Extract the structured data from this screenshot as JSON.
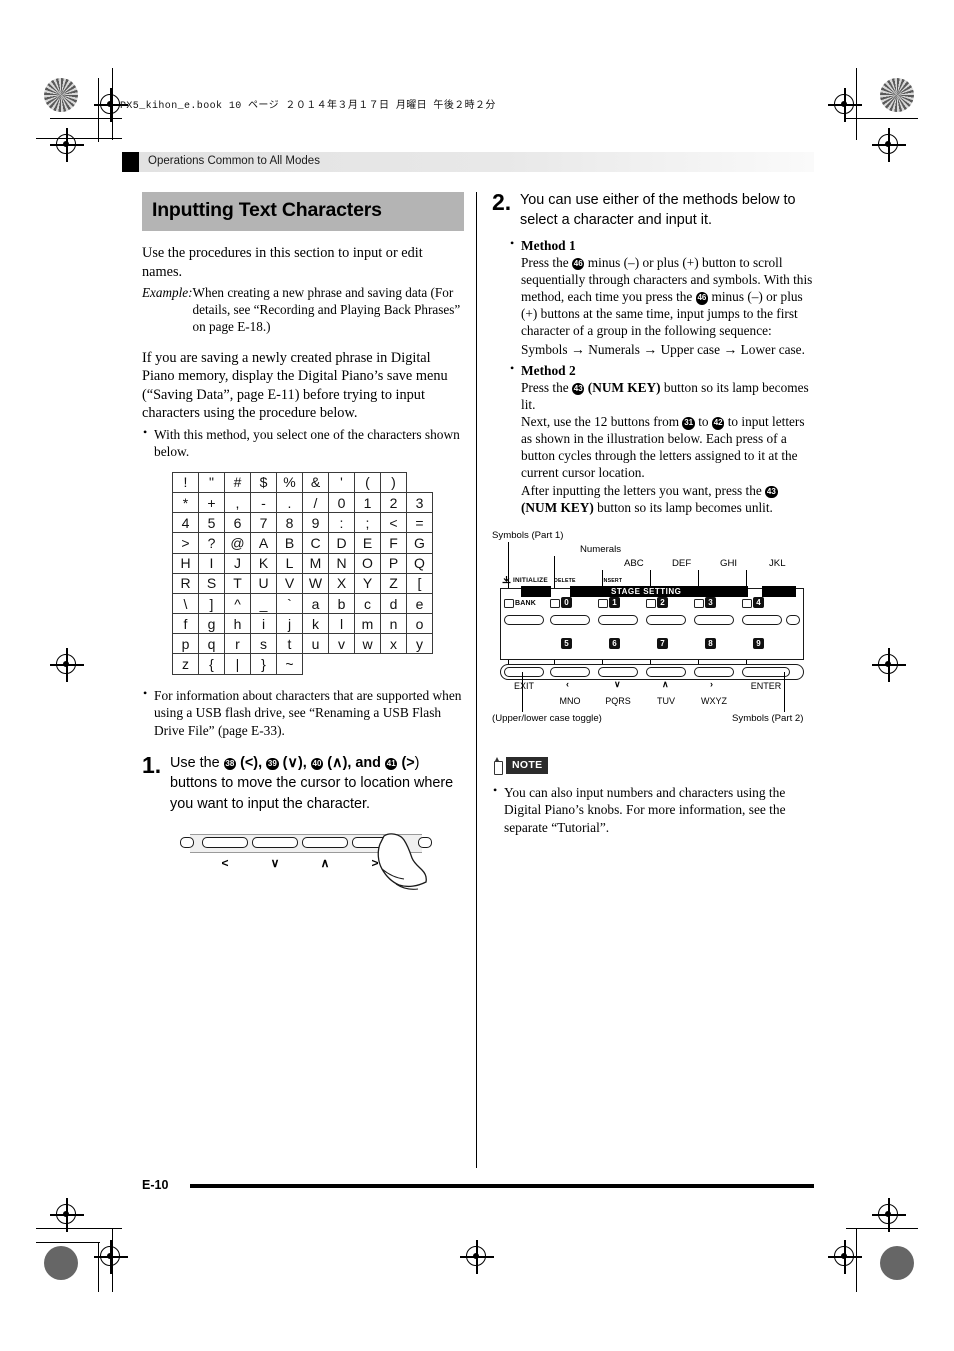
{
  "book_line": "PX5_kihon_e.book   10 ページ   ２０１４年３月１７日   月曜日   午後２時２分",
  "running_head": "Operations Common to All Modes",
  "page_number": "E-10",
  "left_column": {
    "section_title": "Inputting Text Characters",
    "intro": "Use the procedures in this section to input or edit names.",
    "example_label": "Example:",
    "example_text": "When creating a new phrase and saving data (For details, see “Recording and Playing Back Phrases” on page E-18.)",
    "paragraph": "If you are saving a newly created phrase in Digital Piano memory, display the Digital Piano’s save menu (“Saving Data”, page E-11) before trying to input characters using the procedure below.",
    "bullet_above_table": "With this method, you select one of the characters shown below.",
    "bullet_below_table": "For information about characters that are supported when using a USB flash drive, see “Renaming a USB Flash Drive File” (page E-33).",
    "char_table": [
      [
        "!",
        "\"",
        "#",
        "$",
        "%",
        "&",
        "'",
        "(",
        ")"
      ],
      [
        "*",
        "+",
        ",",
        "-",
        ".",
        "/",
        "0",
        "1",
        "2",
        "3"
      ],
      [
        "4",
        "5",
        "6",
        "7",
        "8",
        "9",
        ":",
        ";",
        "<",
        "="
      ],
      [
        ">",
        "?",
        "@",
        "A",
        "B",
        "C",
        "D",
        "E",
        "F",
        "G"
      ],
      [
        "H",
        "I",
        "J",
        "K",
        "L",
        "M",
        "N",
        "O",
        "P",
        "Q"
      ],
      [
        "R",
        "S",
        "T",
        "U",
        "V",
        "W",
        "X",
        "Y",
        "Z",
        "["
      ],
      [
        "\\",
        "]",
        "^",
        "_",
        "`",
        "a",
        "b",
        "c",
        "d",
        "e"
      ],
      [
        "f",
        "g",
        "h",
        "i",
        "j",
        "k",
        "l",
        "m",
        "n",
        "o"
      ],
      [
        "p",
        "q",
        "r",
        "s",
        "t",
        "u",
        "v",
        "w",
        "x",
        "y"
      ],
      [
        "z",
        "{",
        "|",
        "}",
        "~"
      ]
    ],
    "step1": {
      "number": "1.",
      "text_a": "Use the ",
      "ref_38": "38",
      "paren_left": " (",
      "sym_left": "<",
      "after_left": "), ",
      "ref_39": "39",
      "sym_down": "∨",
      "after_down": "), ",
      "ref_40": "40",
      "sym_up": "∧",
      "after_up": "), and ",
      "ref_41": "41",
      "sym_right": ">",
      "text_b": ") buttons to move the cursor to location where you want to input the character."
    },
    "keyboard_glyphs": [
      "<",
      "∨",
      "∧",
      ">"
    ]
  },
  "right_column": {
    "step2": {
      "number": "2.",
      "text": "You can use either of the methods below to select a character and input it."
    },
    "method1": {
      "heading": "Method 1",
      "seg1": "Press the ",
      "ref_a": "46",
      "seg2": " minus (–) or plus (+) button to scroll sequentially through characters and symbols. With this method, each time you press the ",
      "ref_b": "46",
      "seg3": " minus (–) or plus (+) buttons at the same time, input jumps to the first character of a group in the following sequence: Symbols ",
      "arrow": "→",
      "seq1": "Symbols",
      "seq2": "Numerals",
      "seq3": "Upper case",
      "seq4": "Lower case."
    },
    "method2": {
      "heading": "Method 2",
      "p1_a": "Press the ",
      "p1_ref": "43",
      "p1_b": " (NUM KEY) button so its lamp becomes lit.",
      "p2_a": "Next, use the 12 buttons from ",
      "p2_ref1": "31",
      "p2_mid": " to ",
      "p2_ref2": "42",
      "p2_b": " to input letters as shown in the illustration below. Each press of a button cycles through the letters assigned to it at the current cursor location.",
      "p3_a": "After inputting the letters you want, press the ",
      "p3_ref": "43",
      "p3_b": " (NUM KEY) button so its lamp becomes unlit."
    },
    "illustration": {
      "label_symbols_part1": "Symbols (Part 1)",
      "label_numerals": "Numerals",
      "label_abc": "ABC",
      "label_def": "DEF",
      "label_ghi": "GHI",
      "label_jkl": "JKL",
      "label_case_toggle": "(Upper/lower case toggle)",
      "label_symbols_part2": "Symbols (Part 2)",
      "stage_setting": "STAGE SETTING",
      "initialize": "INITIALIZE",
      "delete": "DELETE",
      "insert": "INSERT",
      "bank": "BANK",
      "top_numbers": [
        "0",
        "1",
        "2",
        "3",
        "4"
      ],
      "bottom_numbers": [
        "5",
        "6",
        "7",
        "8",
        "9"
      ],
      "bottom_labels": [
        "EXIT",
        "",
        "",
        "",
        "",
        "ENTER"
      ],
      "letter_groups": [
        "MNO",
        "PQRS",
        "TUV",
        "WXYZ"
      ]
    },
    "note": {
      "label": "NOTE",
      "text": "You can also input numbers and characters using the Digital Piano’s knobs. For more information, see the separate “Tutorial”."
    }
  }
}
